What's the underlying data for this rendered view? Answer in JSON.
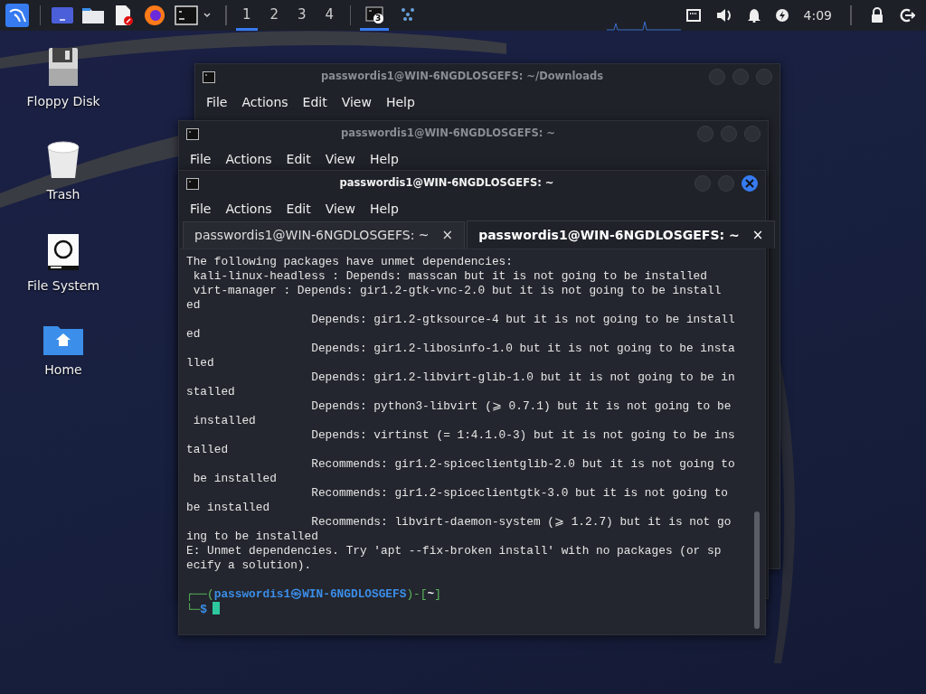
{
  "taskbar": {
    "launchers": [
      {
        "kind": "kali"
      },
      {
        "kind": "desktop"
      },
      {
        "kind": "files"
      },
      {
        "kind": "editor"
      },
      {
        "kind": "browser"
      },
      {
        "kind": "terminal"
      }
    ],
    "workspaces": [
      {
        "label": "1",
        "selected": true
      },
      {
        "label": "2",
        "selected": false
      },
      {
        "label": "3",
        "selected": false
      },
      {
        "label": "4",
        "selected": false
      }
    ],
    "tasks": [
      {
        "kind": "terminal",
        "badge": "3",
        "selected": true
      },
      {
        "kind": "dots",
        "selected": false
      }
    ],
    "clock": "4:09"
  },
  "desktop_icons": [
    {
      "kind": "floppy",
      "label": "Floppy Disk"
    },
    {
      "kind": "trash",
      "label": "Trash"
    },
    {
      "kind": "drive",
      "label": "File System"
    },
    {
      "kind": "home",
      "label": "Home"
    }
  ],
  "windows": [
    {
      "title": "passwordis1@WIN-6NGDLOSGEFS: ~/Downloads",
      "active": false,
      "menu": [
        "File",
        "Actions",
        "Edit",
        "View",
        "Help"
      ]
    },
    {
      "title": "passwordis1@WIN-6NGDLOSGEFS: ~",
      "active": false,
      "menu": [
        "File",
        "Actions",
        "Edit",
        "View",
        "Help"
      ]
    },
    {
      "title": "passwordis1@WIN-6NGDLOSGEFS: ~",
      "active": true,
      "menu": [
        "File",
        "Actions",
        "Edit",
        "View",
        "Help"
      ],
      "tabs": [
        {
          "label": "passwordis1@WIN-6NGDLOSGEFS: ~",
          "close": "×",
          "selected": false
        },
        {
          "label": "passwordis1@WIN-6NGDLOSGEFS: ~",
          "close": "×",
          "selected": true
        }
      ],
      "terminal_lines": [
        "The following packages have unmet dependencies:",
        " kali-linux-headless : Depends: masscan but it is not going to be installed",
        " virt-manager : Depends: gir1.2-gtk-vnc-2.0 but it is not going to be install",
        "ed",
        "                  Depends: gir1.2-gtksource-4 but it is not going to be install",
        "ed",
        "                  Depends: gir1.2-libosinfo-1.0 but it is not going to be insta",
        "lled",
        "                  Depends: gir1.2-libvirt-glib-1.0 but it is not going to be in",
        "stalled",
        "                  Depends: python3-libvirt (⩾ 0.7.1) but it is not going to be",
        " installed",
        "                  Depends: virtinst (= 1:4.1.0-3) but it is not going to be ins",
        "talled",
        "                  Recommends: gir1.2-spiceclientglib-2.0 but it is not going to",
        " be installed",
        "                  Recommends: gir1.2-spiceclientgtk-3.0 but it is not going to",
        "be installed",
        "                  Recommends: libvirt-daemon-system (⩾ 1.2.7) but it is not go",
        "ing to be installed",
        "E: Unmet dependencies. Try 'apt --fix-broken install' with no packages (or sp",
        "ecify a solution)."
      ],
      "prompt": [
        [
          {
            "kind": "frame",
            "text": "┌──("
          },
          {
            "kind": "user",
            "text": "passwordis1㉿WIN-6NGDLOSGEFS"
          },
          {
            "kind": "frame",
            "text": ")-["
          },
          {
            "kind": "path",
            "text": "~"
          },
          {
            "kind": "frame",
            "text": "]"
          }
        ],
        [
          {
            "kind": "frame",
            "text": "└─"
          },
          {
            "kind": "user",
            "text": "$"
          }
        ]
      ]
    }
  ]
}
